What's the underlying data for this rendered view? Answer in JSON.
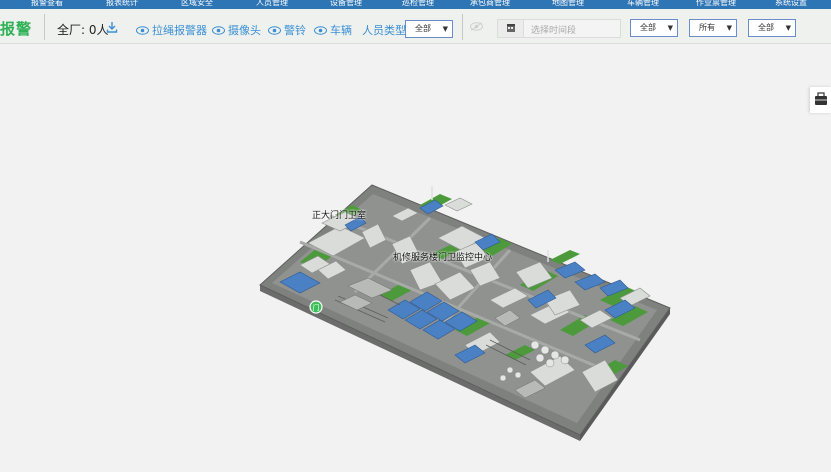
{
  "nav": {
    "items": [
      {
        "label": "报警查看",
        "name": "nav-item-alarm-view"
      },
      {
        "label": "报表统计",
        "name": "nav-item-report-stats"
      },
      {
        "label": "区域安全",
        "name": "nav-item-area-safety"
      },
      {
        "label": "人员管理",
        "name": "nav-item-personnel"
      },
      {
        "label": "设备管理",
        "name": "nav-item-equipment"
      },
      {
        "label": "巡检管理",
        "name": "nav-item-inspection"
      },
      {
        "label": "承包商管理",
        "name": "nav-item-contractor"
      },
      {
        "label": "地图管理",
        "name": "nav-item-map"
      },
      {
        "label": "车辆管理",
        "name": "nav-item-vehicle"
      },
      {
        "label": "作业票管理",
        "name": "nav-item-work-ticket"
      },
      {
        "label": "系统设置",
        "name": "nav-item-settings"
      }
    ]
  },
  "toolbar": {
    "title": "报警",
    "count_text": "全厂: 0人",
    "toggles": {
      "pull_alarm": "拉绳报警器",
      "camera": "摄像头",
      "siren": "警铃",
      "vehicle": "车辆"
    },
    "person_type_label": "人员类型:",
    "person_type_value": "全部",
    "date_placeholder": "选择时间段",
    "filter1_value": "全部",
    "filter2_value": "所有",
    "filter3_value": "全部"
  },
  "map": {
    "labels": {
      "gate": "正大门门卫室",
      "building": "机修服务楼门卫监控中心"
    },
    "marker_text": "门"
  },
  "colors": {
    "nav_bg": "#2e75b6",
    "accent_blue": "#3a8fd4",
    "alarm_green": "#2fb155",
    "select_border": "#6a8cc9"
  }
}
